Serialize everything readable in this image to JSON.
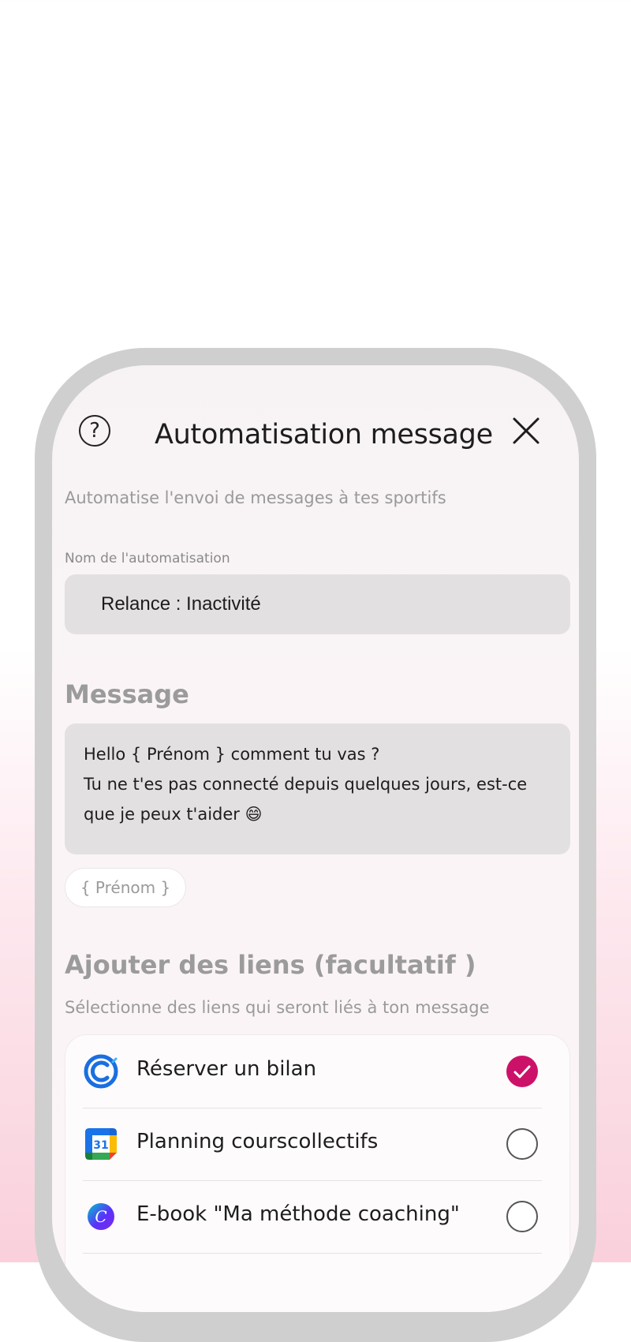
{
  "header": {
    "title": "Automatisation message",
    "help_icon": "help-circle-icon",
    "close_icon": "close-icon"
  },
  "subtitle": "Automatise l'envoi de messages à tes sportifs",
  "name_field": {
    "label": "Nom de l'automatisation",
    "value": "Relance : Inactivité"
  },
  "message": {
    "heading": "Message",
    "text": "Hello { Prénom } comment tu vas ?\nTu ne t'es pas connecté depuis quelques jours, est-ce que je peux t'aider 😄",
    "variable_chip": "{ Prénom }"
  },
  "links": {
    "heading": "Ajouter des liens (facultatif )",
    "description": "Sélectionne des liens qui seront liés à ton message",
    "items": [
      {
        "label": "Réserver un bilan",
        "icon": "calendly-icon",
        "checked": true
      },
      {
        "label": "Planning courscollectifs",
        "icon": "google-calendar-icon",
        "checked": false
      },
      {
        "label": "E-book \"Ma méthode coaching\"",
        "icon": "canva-icon",
        "checked": false
      }
    ]
  },
  "colors": {
    "accent": "#cc1268",
    "input_bg": "#e3e0e1",
    "frame": "#cfcfcf"
  }
}
